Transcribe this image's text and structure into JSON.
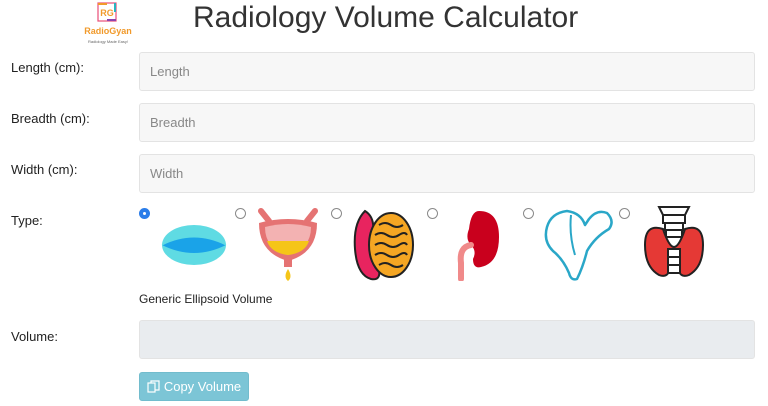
{
  "logo": {
    "initials": "RG",
    "name": "RadioGyan",
    "tagline": "Radiology Made Easy!"
  },
  "title": "Radiology Volume Calculator",
  "fields": {
    "length": {
      "label": "Length (cm):",
      "placeholder": "Length",
      "value": ""
    },
    "breadth": {
      "label": "Breadth (cm):",
      "placeholder": "Breadth",
      "value": ""
    },
    "width": {
      "label": "Width (cm):",
      "placeholder": "Width",
      "value": ""
    }
  },
  "type": {
    "label": "Type:",
    "options": [
      {
        "icon": "ellipsoid-icon",
        "selected": true
      },
      {
        "icon": "bladder-icon",
        "selected": false
      },
      {
        "icon": "testis-icon",
        "selected": false
      },
      {
        "icon": "kidney-icon",
        "selected": false
      },
      {
        "icon": "pancreas-icon",
        "selected": false
      },
      {
        "icon": "thyroid-icon",
        "selected": false
      }
    ],
    "selected_name": "Generic Ellipsoid Volume"
  },
  "volume": {
    "label": "Volume:",
    "value": ""
  },
  "copy_button": {
    "label": "Copy Volume",
    "icon": "copy-icon"
  },
  "colors": {
    "accent": "#2b7de9",
    "copy_button": "#7cc5d6",
    "logo_orange": "#f19a2b"
  }
}
